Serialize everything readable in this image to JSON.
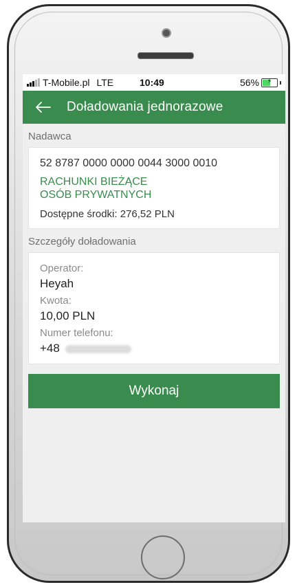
{
  "status_bar": {
    "carrier": "T-Mobile.pl",
    "network": "LTE",
    "time": "10:49",
    "battery": "56%",
    "battery_level": 0.56
  },
  "app_bar": {
    "title": "Doładowania jednorazowe",
    "back_icon": "arrow-left-icon"
  },
  "sender": {
    "header": "Nadawca",
    "account_number": "52 8787 0000 0000 0044 3000 0010",
    "account_name_line1": "RACHUNKI BIEŻĄCE",
    "account_name_line2": "OSÓB PRYWATNYCH",
    "available_funds": "Dostępne środki: 276,52 PLN"
  },
  "details": {
    "header": "Szczegóły doładowania",
    "operator_label": "Operator:",
    "operator_value": "Heyah",
    "amount_label": "Kwota:",
    "amount_value": "10,00 PLN",
    "phone_label": "Numer telefonu:",
    "phone_prefix": "+48"
  },
  "actions": {
    "execute_label": "Wykonaj"
  },
  "colors": {
    "brand_green": "#3a8c4e",
    "background": "#efefef"
  }
}
